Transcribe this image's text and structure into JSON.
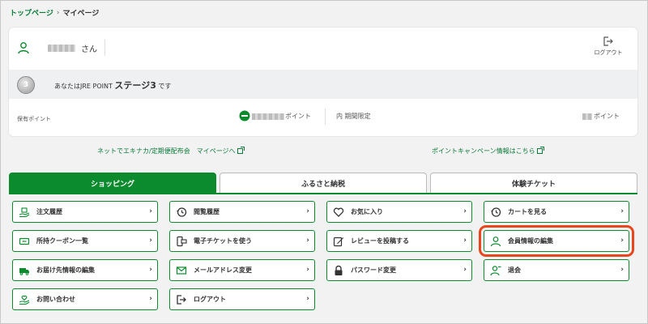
{
  "breadcrumb": {
    "home": "トップページ",
    "sep": "›",
    "current": "マイページ"
  },
  "user": {
    "suffix": "さん",
    "logout_label": "ログアウト"
  },
  "stage": {
    "prefix": "あなたはJRE POINT ",
    "level": "ステージ3",
    "suffix": " です",
    "badge": "3"
  },
  "points": {
    "held_label": "保有ポイント",
    "unit": "ポイント",
    "limited_label": "内 期間限定",
    "limited_unit": "ポイント"
  },
  "links": {
    "left": "ネットでエキナカ/定期便配布会　マイページへ",
    "right": "ポイントキャンペーン情報はこちら"
  },
  "tabs": [
    {
      "label": "ショッピング",
      "active": true
    },
    {
      "label": "ふるさと納税",
      "active": false
    },
    {
      "label": "体験チケット",
      "active": false
    }
  ],
  "menu": [
    {
      "label": "注文履歴",
      "icon": "hand-box-icon"
    },
    {
      "label": "閲覧履歴",
      "icon": "history-icon"
    },
    {
      "label": "お気に入り",
      "icon": "heart-icon"
    },
    {
      "label": "カートを見る",
      "icon": "history-icon"
    },
    {
      "label": "所持クーポン一覧",
      "icon": "coupon-icon"
    },
    {
      "label": "電子チケットを使う",
      "icon": "phone-ticket-icon"
    },
    {
      "label": "レビューを投稿する",
      "icon": "edit-icon"
    },
    {
      "label": "会員情報の編集",
      "icon": "user-icon",
      "highlight": true
    },
    {
      "label": "お届け先情報の編集",
      "icon": "truck-icon"
    },
    {
      "label": "メールアドレス変更",
      "icon": "mail-icon"
    },
    {
      "label": "パスワード変更",
      "icon": "lock-icon"
    },
    {
      "label": "退会",
      "icon": "user-leave-icon"
    },
    {
      "label": "お問い合わせ",
      "icon": "hand-heart-icon"
    },
    {
      "label": "ログアウト",
      "icon": "logout-icon"
    }
  ],
  "chevron": "›",
  "colors": {
    "accent": "#0b8a2e",
    "highlight": "#e8471e",
    "link": "#0b7a3a"
  }
}
